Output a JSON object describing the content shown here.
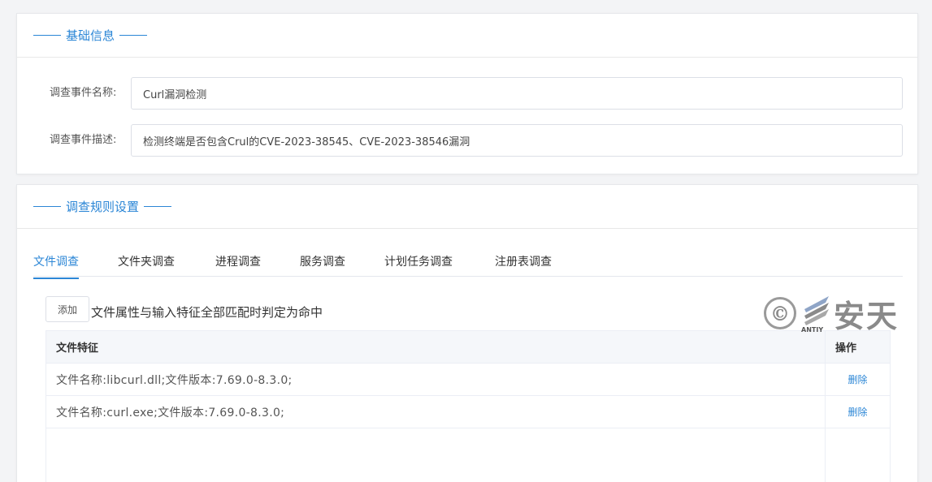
{
  "basic_info": {
    "title": "基础信息",
    "event_name_label": "调查事件名称:",
    "event_name_value": "Curl漏洞检测",
    "event_desc_label": "调查事件描述:",
    "event_desc_value": "检测终端是否包含Crul的CVE-2023-38545、CVE-2023-38546漏洞"
  },
  "rules": {
    "title": "调查规则设置",
    "tabs": [
      {
        "label": "文件调查",
        "active": true
      },
      {
        "label": "文件夹调查",
        "active": false
      },
      {
        "label": "进程调查",
        "active": false
      },
      {
        "label": "服务调查",
        "active": false
      },
      {
        "label": "计划任务调查",
        "active": false
      },
      {
        "label": "注册表调查",
        "active": false
      }
    ],
    "add_label": "添加",
    "match_text": "文件属性与输入特征全部匹配时判定为命中",
    "table": {
      "headers": [
        "文件特征",
        "操作"
      ],
      "rows": [
        {
          "feature": "文件名称:libcurl.dll;文件版本:7.69.0-8.3.0;",
          "action": "删除"
        },
        {
          "feature": "文件名称:curl.exe;文件版本:7.69.0-8.3.0;",
          "action": "删除"
        }
      ]
    }
  },
  "watermark": {
    "brand_text": "安天",
    "logo_sub": "ANTIY"
  },
  "colors": {
    "accent": "#2b86d6",
    "border": "#dcdfe6",
    "table_header_bg": "#f5f7fa"
  }
}
